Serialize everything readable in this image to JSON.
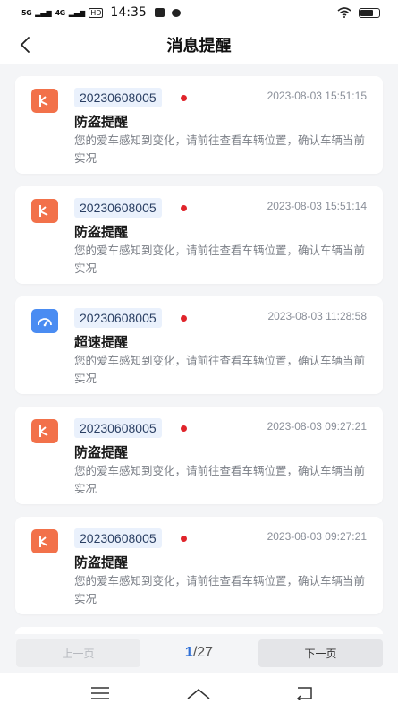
{
  "status_bar": {
    "sig1": "5G",
    "sig2": "4G",
    "hd": "HD",
    "time": "14:35"
  },
  "header": {
    "title": "消息提醒"
  },
  "colors": {
    "theft_icon_bg": "#f2714a",
    "speed_icon_bg": "#4a8cf2",
    "unread_dot": "#e0242b",
    "page_current": "#2f6fd6"
  },
  "messages": [
    {
      "icon": "theft-alert-icon",
      "code": "20230608005",
      "time": "2023-08-03 15:51:15",
      "title": "防盗提醒",
      "desc": "您的爱车感知到变化，请前往查看车辆位置，确认车辆当前实况"
    },
    {
      "icon": "theft-alert-icon",
      "code": "20230608005",
      "time": "2023-08-03 15:51:14",
      "title": "防盗提醒",
      "desc": "您的爱车感知到变化，请前往查看车辆位置，确认车辆当前实况"
    },
    {
      "icon": "speedometer-icon",
      "code": "20230608005",
      "time": "2023-08-03 11:28:58",
      "title": "超速提醒",
      "desc": "您的爱车感知到变化，请前往查看车辆位置，确认车辆当前实况"
    },
    {
      "icon": "theft-alert-icon",
      "code": "20230608005",
      "time": "2023-08-03 09:27:21",
      "title": "防盗提醒",
      "desc": "您的爱车感知到变化，请前往查看车辆位置，确认车辆当前实况"
    },
    {
      "icon": "theft-alert-icon",
      "code": "20230608005",
      "time": "2023-08-03 09:27:21",
      "title": "防盗提醒",
      "desc": "您的爱车感知到变化，请前往查看车辆位置，确认车辆当前实况"
    }
  ],
  "pager": {
    "prev_label": "上一页",
    "next_label": "下一页",
    "current": "1",
    "total": "/27"
  }
}
